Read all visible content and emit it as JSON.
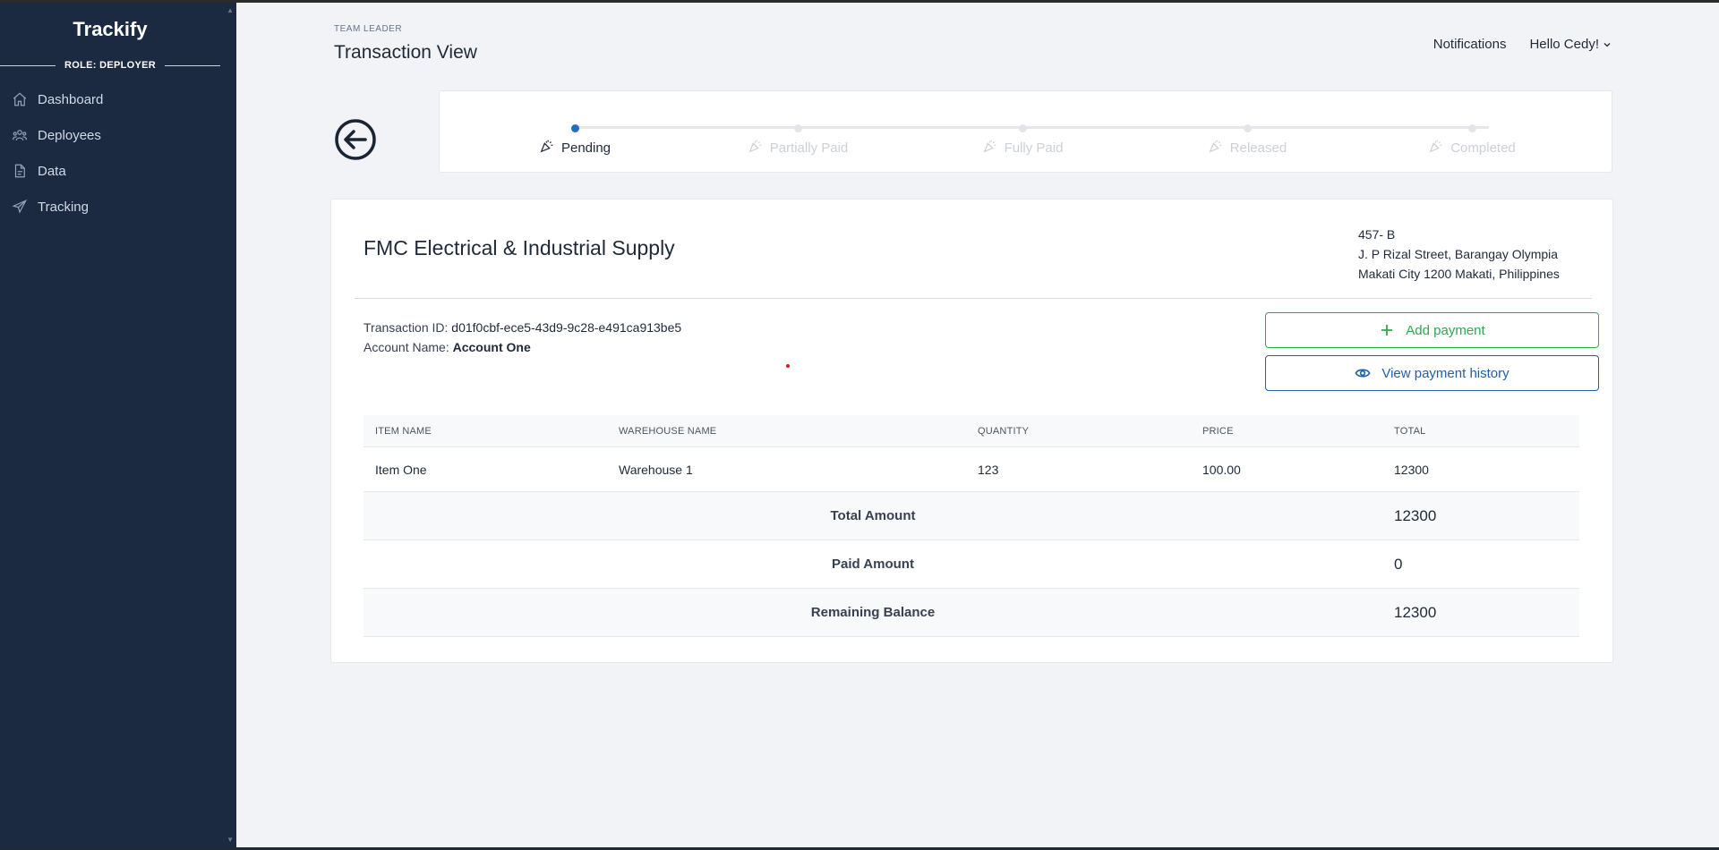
{
  "sidebar": {
    "brand": "Trackify",
    "role": "ROLE: DEPLOYER",
    "items": [
      {
        "label": "Dashboard",
        "icon": "home-icon"
      },
      {
        "label": "Deployees",
        "icon": "users-icon"
      },
      {
        "label": "Data",
        "icon": "file-icon"
      },
      {
        "label": "Tracking",
        "icon": "send-icon"
      }
    ]
  },
  "header": {
    "small": "TEAM LEADER",
    "title": "Transaction View",
    "notifications": "Notifications",
    "user": "Hello Cedy!"
  },
  "stepper": {
    "steps": [
      {
        "label": "Pending",
        "active": true
      },
      {
        "label": "Partially Paid",
        "active": false
      },
      {
        "label": "Fully Paid",
        "active": false
      },
      {
        "label": "Released",
        "active": false
      },
      {
        "label": "Completed",
        "active": false
      }
    ]
  },
  "transaction": {
    "company": "FMC Electrical & Industrial Supply",
    "address": [
      "457- B",
      "J. P Rizal Street, Barangay Olympia",
      "Makati City 1200 Makati, Philippines"
    ],
    "id_label": "Transaction ID:",
    "id_value": "d01f0cbf-ece5-43d9-9c28-e491ca913be5",
    "account_label": "Account Name:",
    "account_value": "Account One",
    "add_payment": "Add payment",
    "view_history": "View payment history"
  },
  "table": {
    "headers": [
      "ITEM NAME",
      "WAREHOUSE NAME",
      "QUANTITY",
      "PRICE",
      "TOTAL"
    ],
    "rows": [
      [
        "Item One",
        "Warehouse 1",
        "123",
        "100.00",
        "12300"
      ]
    ],
    "summary": [
      {
        "label": "Total Amount",
        "value": "12300"
      },
      {
        "label": "Paid Amount",
        "value": "0"
      },
      {
        "label": "Remaining Balance",
        "value": "12300"
      }
    ]
  },
  "colors": {
    "sidebar_bg": "#1b2a40",
    "accent_blue": "#1f5fa8",
    "accent_green": "#2fa84f",
    "step_active": "#1f6fc8"
  }
}
